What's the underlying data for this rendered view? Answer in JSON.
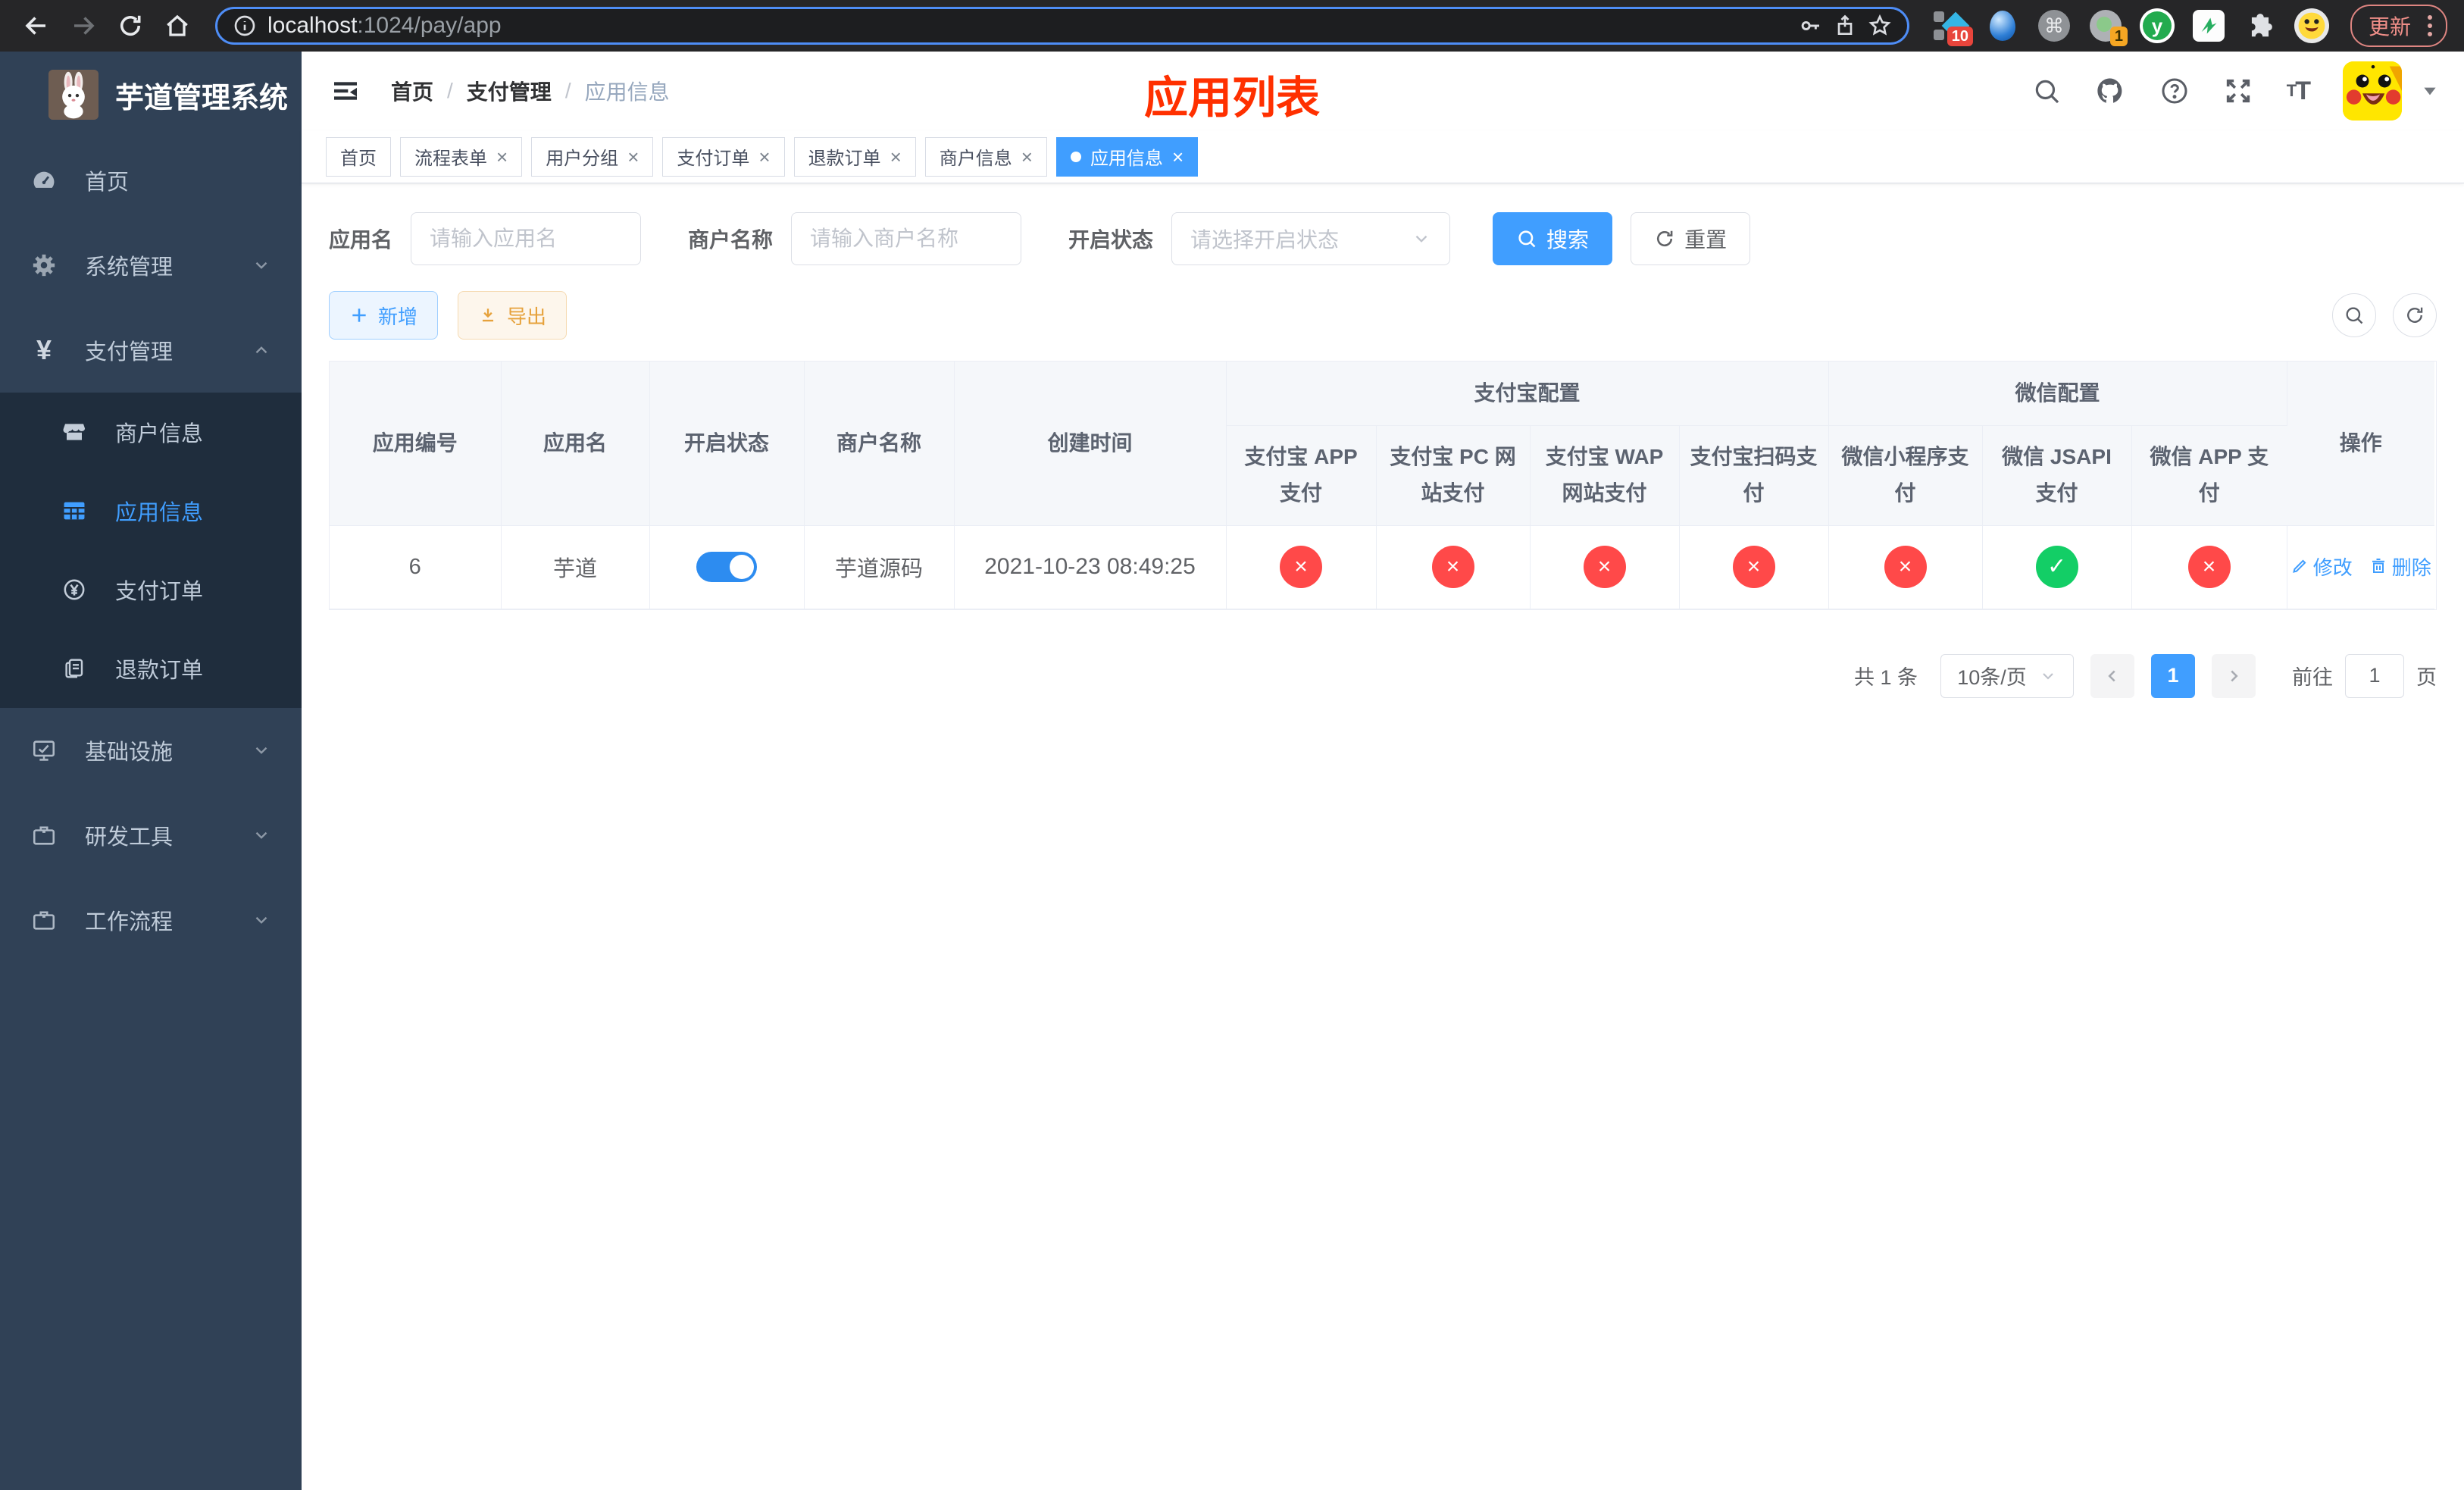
{
  "browser": {
    "url_host": "localhost",
    "url_path": ":1024/pay/app",
    "extension_badge_a": "10",
    "extension_badge_b": "1",
    "update_label": "更新"
  },
  "sidebar": {
    "title": "芋道管理系统",
    "menu": [
      {
        "label": "首页"
      },
      {
        "label": "系统管理"
      },
      {
        "label": "支付管理"
      },
      {
        "label": "基础设施"
      },
      {
        "label": "研发工具"
      },
      {
        "label": "工作流程"
      }
    ],
    "submenu": [
      {
        "label": "商户信息"
      },
      {
        "label": "应用信息"
      },
      {
        "label": "支付订单"
      },
      {
        "label": "退款订单"
      }
    ]
  },
  "navbar": {
    "breadcrumb": [
      "首页",
      "支付管理",
      "应用信息"
    ],
    "separator": "/"
  },
  "overlay_title": "应用列表",
  "ui": {
    "close_glyph": "×"
  },
  "tabs": [
    {
      "label": "首页"
    },
    {
      "label": "流程表单"
    },
    {
      "label": "用户分组"
    },
    {
      "label": "支付订单"
    },
    {
      "label": "退款订单"
    },
    {
      "label": "商户信息"
    },
    {
      "label": "应用信息"
    }
  ],
  "filters": {
    "app_name_label": "应用名",
    "app_name_placeholder": "请输入应用名",
    "merchant_label": "商户名称",
    "merchant_placeholder": "请输入商户名称",
    "status_label": "开启状态",
    "status_placeholder": "请选择开启状态",
    "search_label": "搜索",
    "reset_label": "重置"
  },
  "toolbar": {
    "add_label": "新增",
    "export_label": "导出"
  },
  "table": {
    "columns": {
      "app_id": "应用编号",
      "app_name": "应用名",
      "status": "开启状态",
      "merchant": "商户名称",
      "created": "创建时间",
      "alipay_group": "支付宝配置",
      "wechat_group": "微信配置",
      "alipay": [
        "支付宝 APP 支付",
        "支付宝 PC 网站支付",
        "支付宝 WAP 网站支付",
        "支付宝扫码支付"
      ],
      "wechat": [
        "微信小程序支付",
        "微信 JSAPI 支付",
        "微信 APP 支付"
      ],
      "ops": "操作"
    },
    "row": {
      "app_id": "6",
      "app_name": "芋道",
      "enabled": "on",
      "merchant": "芋道源码",
      "created": "2021-10-23 08:49:25",
      "payments": [
        {
          "state": "off",
          "glyph": "×"
        },
        {
          "state": "off",
          "glyph": "×"
        },
        {
          "state": "off",
          "glyph": "×"
        },
        {
          "state": "off",
          "glyph": "×"
        },
        {
          "state": "off",
          "glyph": "×"
        },
        {
          "state": "on",
          "glyph": "✓"
        },
        {
          "state": "off",
          "glyph": "×"
        }
      ],
      "edit_label": "修改",
      "delete_label": "删除"
    }
  },
  "pagination": {
    "total": "共 1 条",
    "page_size": "10条/页",
    "current_page": "1",
    "goto_label": "前往",
    "goto_value": "1",
    "unit_label": "页"
  },
  "colors": {
    "accent": "#409eff",
    "sidebar_bg": "#304156",
    "submenu_bg": "#1f2d3d",
    "danger": "#ff4949",
    "success": "#13ce66",
    "warning": "#e6a23c",
    "overlay_title": "#ff3000"
  }
}
